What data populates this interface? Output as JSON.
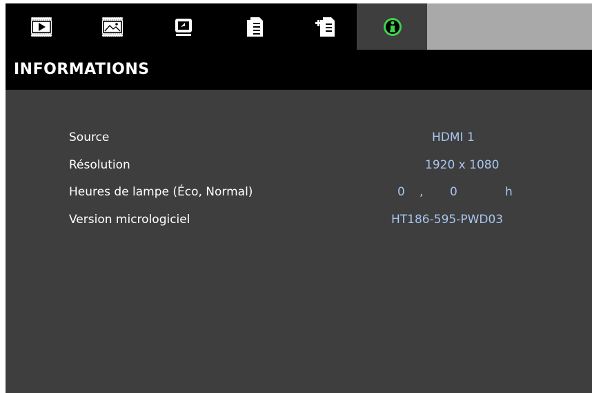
{
  "tabs": [
    {
      "icon": "play-image-icon",
      "active": false
    },
    {
      "icon": "picture-adjust-icon",
      "active": false
    },
    {
      "icon": "display-screen-icon",
      "active": false
    },
    {
      "icon": "document-settings-icon",
      "active": false
    },
    {
      "icon": "add-document-icon",
      "active": false
    },
    {
      "icon": "info-circle-icon",
      "active": true
    }
  ],
  "page": {
    "title": "INFORMATIONS"
  },
  "info": {
    "source": {
      "label": "Source",
      "value": "HDMI 1"
    },
    "resolution": {
      "label": "Résolution",
      "value": "1920 x 1080"
    },
    "lamp_hours": {
      "label": "Heures de lampe (Éco, Normal)",
      "eco": "0",
      "separator": ",",
      "normal": "0",
      "unit": "h"
    },
    "firmware": {
      "label": "Version micrologiciel",
      "value": "HT186-595-PWD03"
    }
  },
  "colors": {
    "accent": "#3fd24c",
    "value_text": "#a9c5ee",
    "panel": "#3e3e3e",
    "bar": "#000000"
  }
}
